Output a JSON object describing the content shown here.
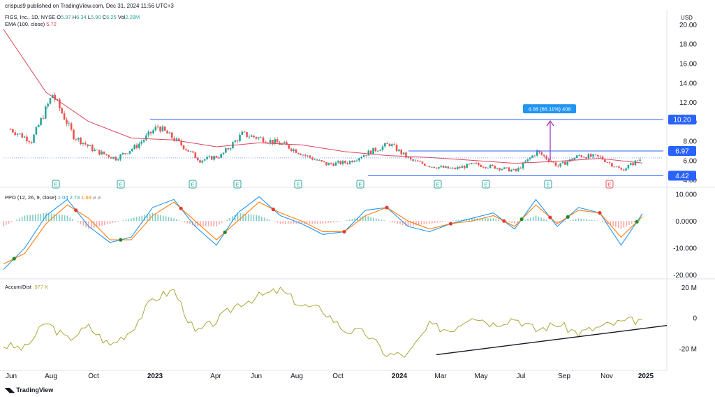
{
  "header": {
    "published": "crispus9 published on TradingView.com, Dec 31, 2024 11:56 UTC+3",
    "symbol": "FIGS, Inc., 1D, NYSE",
    "ohlc": [
      {
        "label": "O",
        "value": "5.97"
      },
      {
        "label": "H",
        "value": "6.34"
      },
      {
        "label": "L",
        "value": "5.90"
      },
      {
        "label": "C",
        "value": "6.25"
      },
      {
        "label": "Vol",
        "value": "2.28M"
      }
    ],
    "ema_label": "EMA (100, close)",
    "ema_value": "5.72",
    "currency": "USD"
  },
  "measure": {
    "label": "4.08 (66.11%) 408"
  },
  "price_badges": [
    "10.20",
    "6.97",
    "4.42"
  ],
  "ppo": {
    "label": "PPO (12, 26, 9, close)",
    "values": [
      "1.04",
      "2.73",
      "1.69"
    ]
  },
  "accum": {
    "label": "Accum/Dist",
    "value": "-977 K"
  },
  "footer": {
    "brand": "TradingView"
  },
  "colors": {
    "up": "#26a69a",
    "down": "#ef5350",
    "ema": "#e0455b",
    "line": "#2962ff",
    "ppo": "#2196f3",
    "signal": "#ff7f0e",
    "ad": "#aaa63a",
    "measure": "#9c27b0"
  },
  "chart_data": [
    {
      "type": "line",
      "title": "FIGS, Inc., 1D, NYSE",
      "ylim": [
        3.8,
        20.5
      ],
      "y_ticks": [
        "20.00",
        "18.00",
        "16.00",
        "14.00",
        "12.00",
        "10.00",
        "8.00",
        "6.00",
        "4.00"
      ],
      "x_tick_labels": [
        "Jun",
        "Aug",
        "Oct",
        "2023",
        "Apr",
        "Jun",
        "Aug",
        "Oct",
        "2024",
        "Mar",
        "May",
        "Jul",
        "Sep",
        "Nov",
        "2025"
      ],
      "series": [
        {
          "name": "FIGS",
          "x": [
            "Jun 2022",
            "Jul 2022",
            "Aug 2022",
            "Sep 2022",
            "Oct 2022",
            "Nov 2022",
            "Dec 2022",
            "Jan 2023",
            "Feb 2023",
            "Mar 2023",
            "Apr 2023",
            "May 2023",
            "Jun 2023",
            "Jul 2023",
            "Aug 2023",
            "Sep 2023",
            "Oct 2023",
            "Nov 2023",
            "Dec 2023",
            "Jan 2024",
            "Feb 2024",
            "Mar 2024",
            "Apr 2024",
            "May 2024",
            "Jun 2024",
            "Jul 2024",
            "Aug 2024",
            "Sep 2024",
            "Oct 2024",
            "Nov 2024",
            "Dec 2024"
          ],
          "values": [
            9.2,
            8.0,
            12.8,
            8.5,
            7.0,
            6.2,
            7.5,
            9.5,
            7.8,
            6.0,
            6.5,
            8.7,
            8.2,
            7.6,
            6.5,
            5.6,
            5.8,
            6.8,
            7.7,
            6.0,
            5.4,
            5.1,
            5.6,
            5.3,
            4.9,
            6.9,
            5.4,
            6.5,
            6.3,
            5.0,
            6.25
          ]
        },
        {
          "name": "EMA (100, close)",
          "x": [
            "Jun 2022",
            "Aug 2022",
            "Oct 2022",
            "Dec 2022",
            "Feb 2023",
            "Apr 2023",
            "Jun 2023",
            "Aug 2023",
            "Oct 2023",
            "Dec 2023",
            "Feb 2024",
            "Apr 2024",
            "Jun 2024",
            "Aug 2024",
            "Oct 2024",
            "Dec 2024"
          ],
          "values": [
            19.5,
            13.0,
            10.0,
            8.3,
            8.1,
            7.4,
            7.8,
            7.6,
            6.9,
            6.5,
            6.3,
            6.0,
            5.7,
            5.9,
            6.2,
            5.72
          ]
        }
      ],
      "horizontal_lines": [
        10.2,
        6.97,
        4.42
      ],
      "annotation": "4.08 (66.11%) 408"
    },
    {
      "type": "line",
      "title": "PPO (12, 26, 9, close)",
      "ylim": [
        -21,
        12
      ],
      "y_ticks": [
        "10.000",
        "0.0000",
        "-10.000",
        "-20.000"
      ],
      "series": [
        {
          "name": "PPO",
          "values": [
            -18,
            -10,
            2,
            8,
            -2,
            -8,
            -6,
            5,
            8,
            -2,
            -9,
            3,
            9,
            2,
            -1,
            -5,
            -4,
            4,
            5,
            -2,
            -4,
            -1,
            1,
            3,
            -3,
            8,
            -2,
            5,
            3,
            -9,
            2.73
          ]
        },
        {
          "name": "Signal",
          "values": [
            -16,
            -12,
            -1,
            6,
            1,
            -7,
            -7,
            2,
            7,
            0,
            -7,
            0,
            7,
            3,
            0,
            -4,
            -4,
            2,
            5,
            0,
            -3,
            -1,
            0,
            2,
            -2,
            6,
            -1,
            4,
            3,
            -6,
            1.69
          ]
        }
      ]
    },
    {
      "type": "line",
      "title": "Accum/Dist",
      "ylim": [
        -32,
        24
      ],
      "y_ticks": [
        "20 M",
        "0",
        "-20 M"
      ],
      "series": [
        {
          "name": "Accum/Dist",
          "values": [
            -18,
            -20,
            -3,
            -14,
            -6,
            -18,
            -8,
            12,
            18,
            -10,
            -2,
            9,
            14,
            18,
            8,
            5,
            -8,
            -10,
            -24,
            -24,
            -5,
            -8,
            2,
            -4,
            0,
            -8,
            -4,
            -10,
            -6,
            -3,
            -0.98
          ]
        }
      ]
    }
  ]
}
